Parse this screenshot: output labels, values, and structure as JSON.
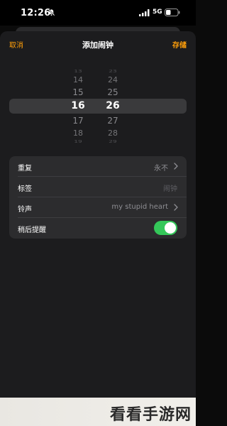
{
  "status_bar": {
    "time": "12:26",
    "network": "5G",
    "icons": [
      "bell-muted-icon",
      "signal-bars-icon",
      "battery-icon"
    ]
  },
  "nav": {
    "cancel_label": "取消",
    "title": "添加闹钟",
    "save_label": "存储"
  },
  "time_picker": {
    "hours": [
      "13",
      "14",
      "15",
      "16",
      "17",
      "18",
      "19"
    ],
    "minutes": [
      "23",
      "24",
      "25",
      "26",
      "27",
      "28",
      "29"
    ],
    "selected_hour": "16",
    "selected_minute": "26"
  },
  "settings": {
    "repeat": {
      "label": "重复",
      "value": "永不"
    },
    "label": {
      "label": "标签",
      "placeholder": "闹钟"
    },
    "sound": {
      "label": "铃声",
      "value": "my stupid heart"
    },
    "snooze": {
      "label": "稍后提醒",
      "enabled": true
    }
  },
  "colors": {
    "accent": "#ff9f0a",
    "toggle_on": "#34c759",
    "sheet": "#1c1c1e",
    "group": "#2c2c2e"
  },
  "watermark": {
    "text": "看看手游网"
  }
}
